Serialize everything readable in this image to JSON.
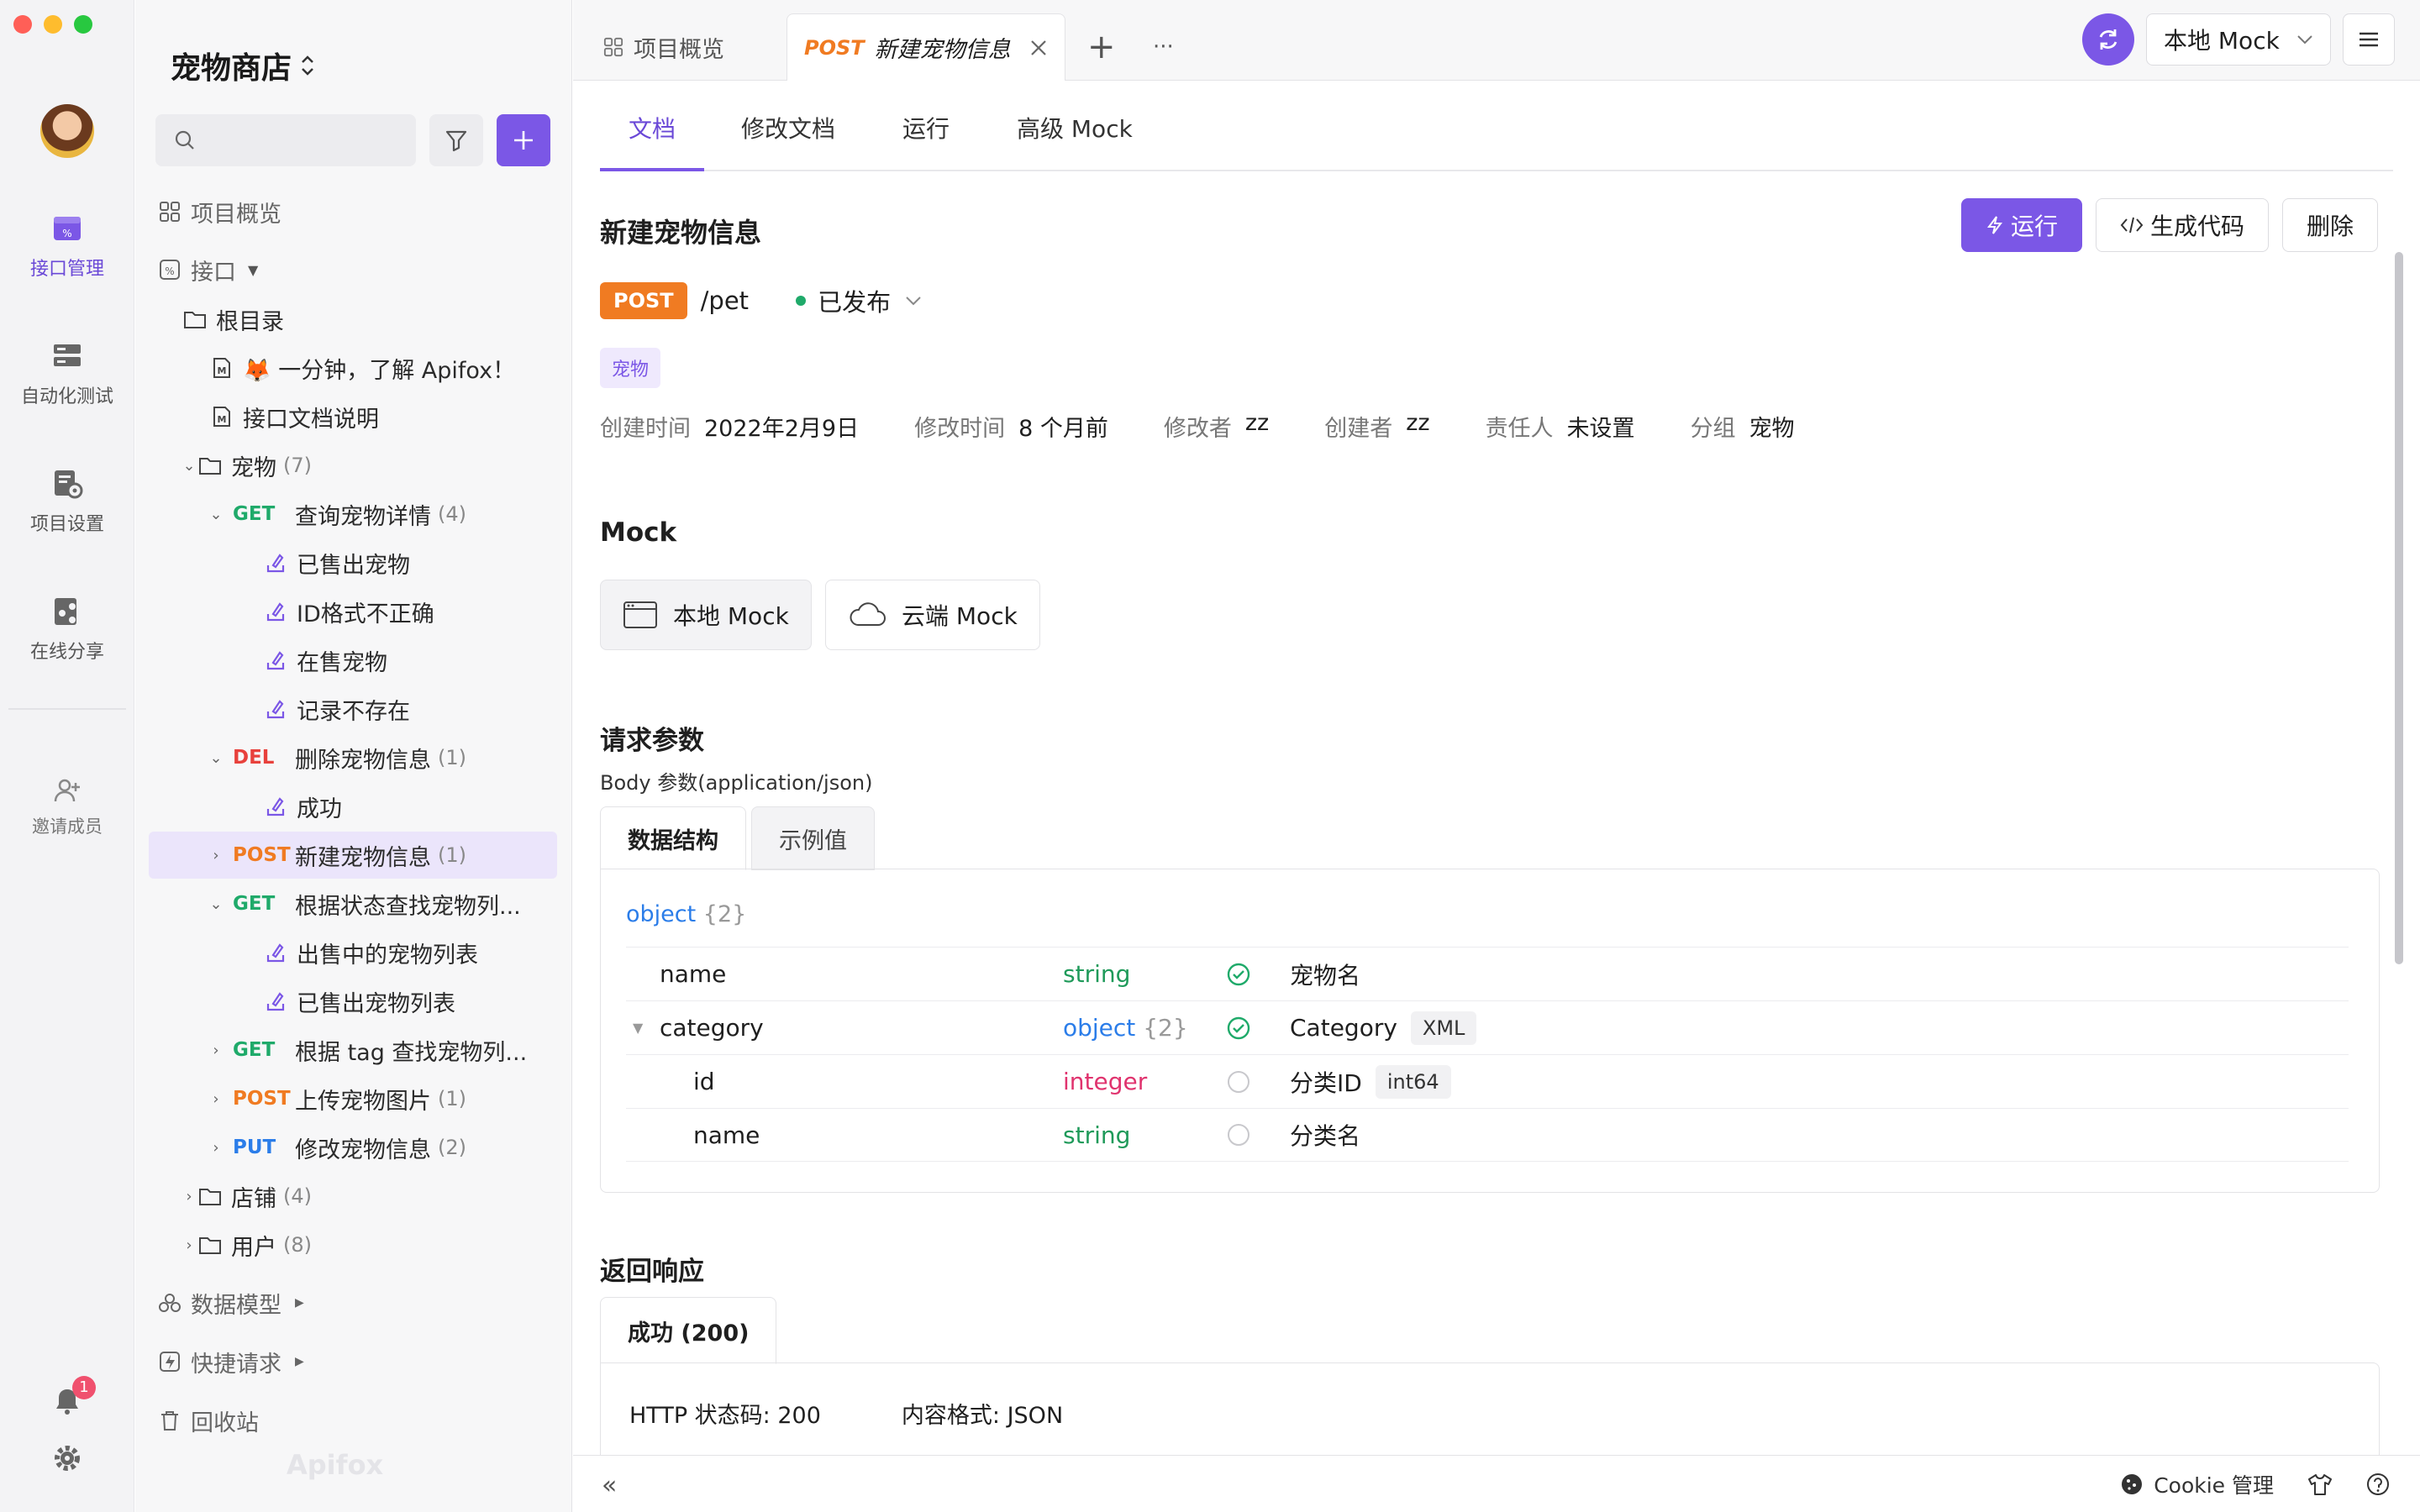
{
  "project": {
    "name": "宠物商店"
  },
  "rail": {
    "items": [
      {
        "label": "接口管理",
        "active": true
      },
      {
        "label": "自动化测试"
      },
      {
        "label": "项目设置"
      },
      {
        "label": "在线分享"
      },
      {
        "label": "邀请成员"
      }
    ],
    "notification_count": "1"
  },
  "sidebar": {
    "overview": "项目概览",
    "interfaces": "接口",
    "root": "根目录",
    "doc1": "🦊 一分钟，了解 Apifox！",
    "doc2": "接口文档说明",
    "folder_pets": {
      "label": "宠物",
      "count": "(7)"
    },
    "get_pet_detail": {
      "method": "GET",
      "label": "查询宠物详情",
      "count": "(4)"
    },
    "case_sold": "已售出宠物",
    "case_id_invalid": "ID格式不正确",
    "case_on_sale": "在售宠物",
    "case_not_exist": "记录不存在",
    "del_pet": {
      "method": "DEL",
      "label": "删除宠物信息",
      "count": "(1)"
    },
    "case_success": "成功",
    "post_pet": {
      "method": "POST",
      "label": "新建宠物信息",
      "count": "(1)"
    },
    "get_by_status": {
      "method": "GET",
      "label": "根据状态查找宠物列..."
    },
    "case_for_sale_list": "出售中的宠物列表",
    "case_sold_list": "已售出宠物列表",
    "get_by_tag": {
      "method": "GET",
      "label": "根据 tag 查找宠物列..."
    },
    "post_upload": {
      "method": "POST",
      "label": "上传宠物图片",
      "count": "(1)"
    },
    "put_pet": {
      "method": "PUT",
      "label": "修改宠物信息",
      "count": "(2)"
    },
    "folder_store": {
      "label": "店铺",
      "count": "(4)"
    },
    "folder_user": {
      "label": "用户",
      "count": "(8)"
    },
    "data_models": "数据模型",
    "quick_request": "快捷请求",
    "trash": "回收站",
    "watermark": "Apifox"
  },
  "topbar": {
    "tab_overview": "项目概览",
    "tab_active_method": "POST",
    "tab_active_title": "新建宠物信息",
    "add": "+",
    "more": "···",
    "env": "本地 Mock"
  },
  "subtabs": [
    "文档",
    "修改文档",
    "运行",
    "高级 Mock"
  ],
  "api": {
    "title": "新建宠物信息",
    "run": "运行",
    "gen_code": "生成代码",
    "delete": "删除",
    "method": "POST",
    "path": "/pet",
    "status": "已发布",
    "tag": "宠物",
    "meta": [
      {
        "k": "创建时间",
        "v": "2022年2月9日"
      },
      {
        "k": "修改时间",
        "v": "8 个月前"
      },
      {
        "k": "修改者",
        "v": "zz"
      },
      {
        "k": "创建者",
        "v": "zz"
      },
      {
        "k": "责任人",
        "v": "未设置"
      },
      {
        "k": "分组",
        "v": "宠物"
      }
    ]
  },
  "mock": {
    "title": "Mock",
    "local": "本地 Mock",
    "cloud": "云端 Mock"
  },
  "request": {
    "title": "请求参数",
    "body_label": "Body 参数(application/json)",
    "tab_schema": "数据结构",
    "tab_example": "示例值",
    "root_type": "object",
    "root_count": "{2}",
    "rows": [
      {
        "name": "name",
        "type": "string",
        "required": true,
        "desc": "宠物名"
      },
      {
        "name": "category",
        "type": "object",
        "type_count": "{2}",
        "required": true,
        "desc": "Category",
        "pill": "XML"
      },
      {
        "name": "id",
        "type": "integer",
        "required": false,
        "desc": "分类ID",
        "pill": "int64"
      },
      {
        "name": "name",
        "type": "string",
        "required": false,
        "desc": "分类名"
      }
    ]
  },
  "response": {
    "title": "返回响应",
    "tab": "成功 (200)",
    "http_status": "HTTP 状态码: 200",
    "content_type": "内容格式: JSON"
  },
  "footer": {
    "collapse": "«",
    "cookie": "Cookie 管理"
  },
  "colors": {
    "accent": "#7b57e6",
    "post": "#f07b22",
    "get": "#1faa6a",
    "del": "#e8413c",
    "put": "#2b7de9"
  }
}
